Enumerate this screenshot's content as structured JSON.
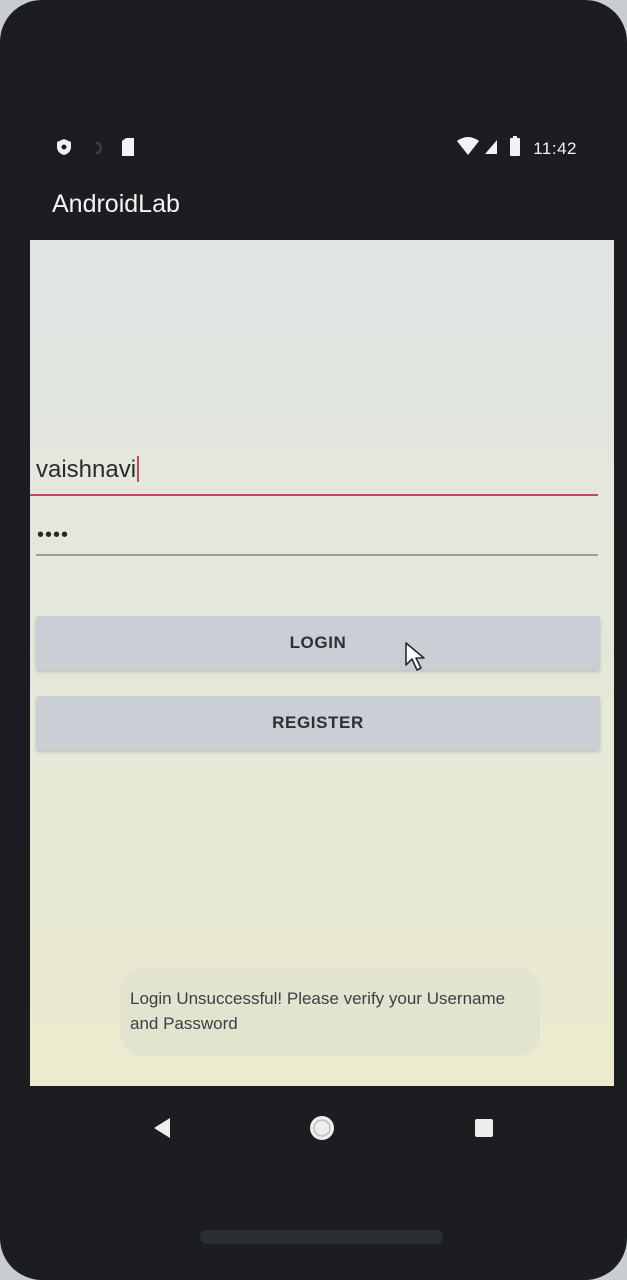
{
  "status_bar": {
    "time": "11:42",
    "left_icons": [
      "shield-icon",
      "sync-icon",
      "sim-card-icon"
    ],
    "right_icons": [
      "wifi-icon",
      "cell-signal-icon",
      "battery-icon"
    ]
  },
  "app": {
    "title": "AndroidLab"
  },
  "form": {
    "username_value": "vaishnavi",
    "password_value": "••••",
    "login_label": "LOGIN",
    "register_label": "REGISTER"
  },
  "toast": {
    "message": "Login Unsuccessful! Please verify your Username and Password"
  },
  "nav_bar": {
    "buttons": [
      "back-icon",
      "home-icon",
      "recents-icon"
    ]
  },
  "colors": {
    "focus_underline": "#c24b60",
    "button_bg": "#c9cfd4",
    "app_bar_bg": "#1b1d21"
  }
}
